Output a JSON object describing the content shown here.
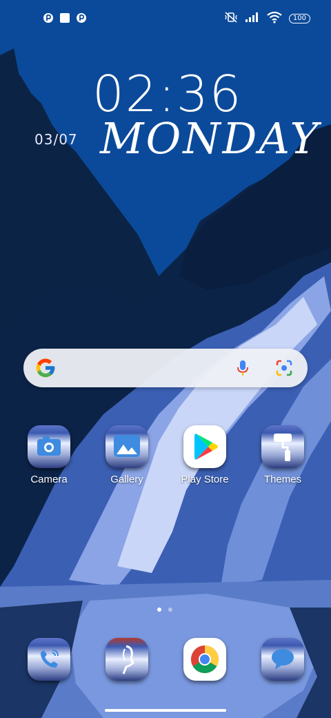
{
  "status_bar": {
    "notifications": [
      "notification-icon",
      "square-notification-icon",
      "notification-icon"
    ],
    "battery": "100",
    "icons": [
      "mute-vibrate-icon",
      "signal-icon",
      "wifi-icon",
      "battery-icon"
    ]
  },
  "lockscreen": {
    "time": "02:36",
    "date": "03/07",
    "weekday": "MONDAY"
  },
  "search": {
    "icons": [
      "google-icon",
      "mic-icon",
      "lens-icon"
    ]
  },
  "apps": [
    {
      "label": "Camera",
      "icon": "camera-icon"
    },
    {
      "label": "Gallery",
      "icon": "gallery-icon"
    },
    {
      "label": "Play Store",
      "icon": "play-store-icon"
    },
    {
      "label": "Themes",
      "icon": "themes-icon"
    }
  ],
  "dock": [
    {
      "icon": "phone-icon"
    },
    {
      "icon": "contacts-icon"
    },
    {
      "icon": "chrome-icon"
    },
    {
      "icon": "messages-icon"
    }
  ],
  "page_indicator": {
    "pages": 2,
    "current": 1
  },
  "colors": {
    "sky": "#0b4a9a",
    "forest": "#0b2345",
    "water": "#6f8fd8",
    "accent": "#4285f4"
  }
}
